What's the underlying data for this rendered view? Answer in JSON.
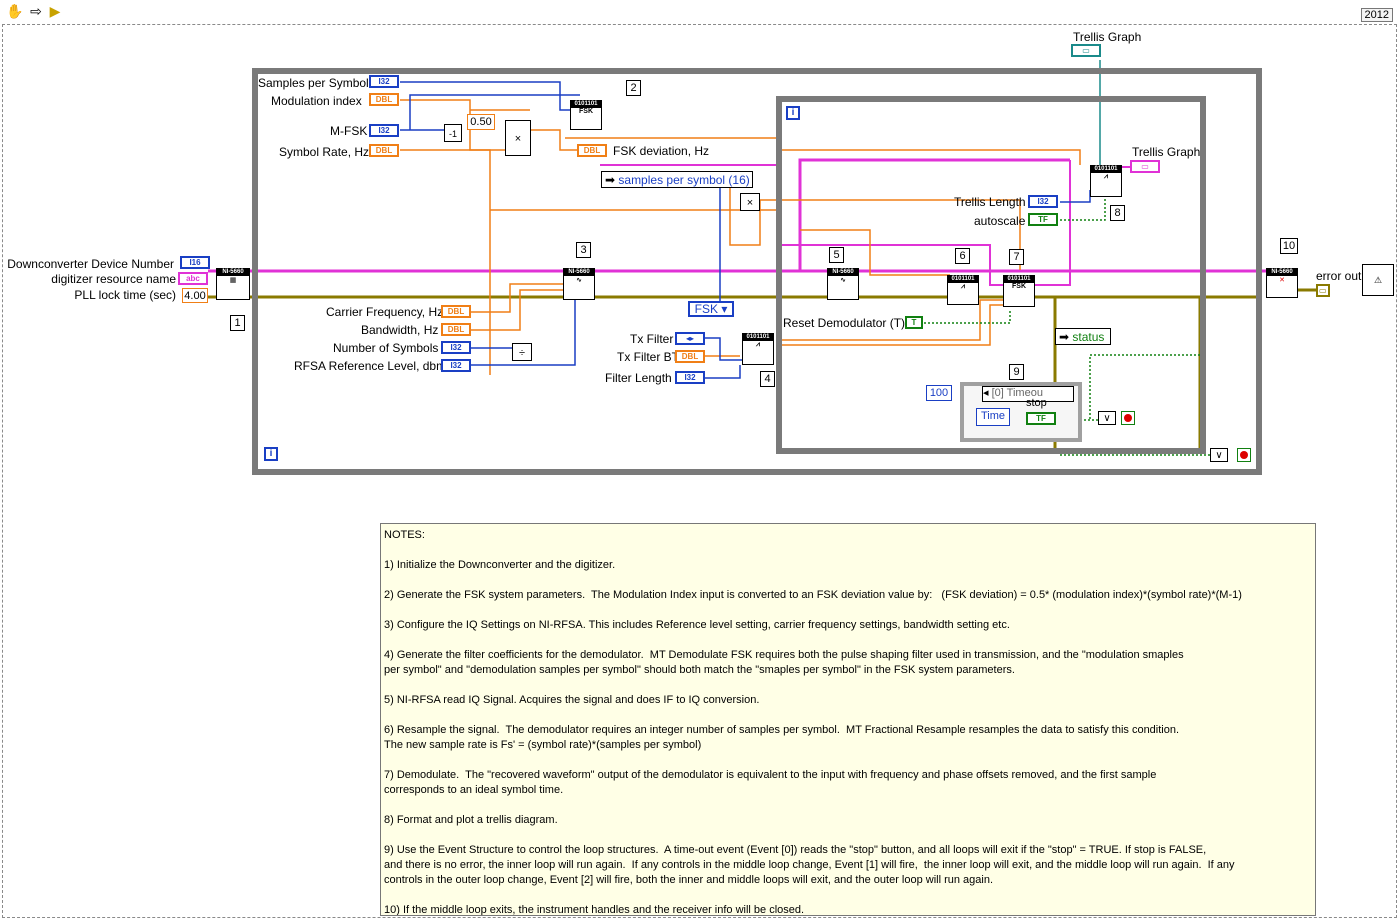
{
  "toolbar": {
    "version": "2012"
  },
  "inputs_left": {
    "downconverter_device_number": "Downconverter Device Number",
    "digitizer_resource_name": "digitizer resource name",
    "pll_lock_time": "PLL lock time (sec)",
    "pll_lock_time_value": "4.00"
  },
  "outer_loop": {
    "samples_per_symbol": "Samples per Symbol",
    "modulation_index": "Modulation index",
    "m_fsk": "M-FSK",
    "symbol_rate": "Symbol Rate, Hz",
    "const_050": "0.50",
    "fsk_deviation": "FSK deviation, Hz",
    "samples_per_symbol_16": "samples per symbol (16)",
    "carrier_frequency": "Carrier Frequency, Hz",
    "bandwidth": "Bandwidth, Hz",
    "number_of_symbols": "Number of Symbols",
    "rfsa_reference_level": "RFSA Reference Level, dbm",
    "tx_filter": "Tx Filter",
    "tx_filter_bt": "Tx Filter BT",
    "filter_length": "Filter Length",
    "fsk_enum": "FSK",
    "loop_i": "i"
  },
  "inner_loop": {
    "reset_demodulator": "Reset Demodulator (T)",
    "trellis_length": "Trellis Length",
    "autoscale": "autoscale",
    "trellis_graph": "Trellis Graph",
    "status": "status",
    "event_case": "[0] Timeou",
    "timeout_value": "100",
    "time": "Time",
    "stop": "stop",
    "loop_i": "i"
  },
  "top": {
    "trellis_graph": "Trellis Graph"
  },
  "right": {
    "error_out": "error out"
  },
  "term_labels": {
    "i32": "I32",
    "dbl": "DBL",
    "i16": "I16",
    "str": "abc",
    "tf": "TF",
    "ni5660": "NI-5660",
    "binary": "0101101",
    "fsk": "FSK"
  },
  "step_numbers": [
    "1",
    "2",
    "3",
    "4",
    "5",
    "6",
    "7",
    "8",
    "9",
    "10"
  ],
  "notes": {
    "title": "NOTES:",
    "items": [
      "1) Initialize the Downconverter and the digitizer.",
      "2) Generate the FSK system parameters.  The Modulation Index input is converted to an FSK deviation value by:   (FSK deviation) = 0.5* (modulation index)*(symbol rate)*(M-1)",
      "3) Configure the IQ Settings on NI-RFSA. This includes Reference level setting, carrier frequency settings, bandwidth setting etc.",
      "4) Generate the filter coefficients for the demodulator.  MT Demodulate FSK requires both the pulse shaping filter used in transmission, and the \"modulation smaples\nper symbol\" and \"demodulation samples per symbol\" should both match the \"smaples per symbol\" in the FSK system parameters.",
      "5) NI-RFSA read IQ Signal. Acquires the signal and does IF to IQ conversion.",
      "6) Resample the signal.  The demodulator requires an integer number of samples per symbol.  MT Fractional Resample resamples the data to satisfy this condition.\nThe new sample rate is Fs' = (symbol rate)*(samples per symbol)",
      "7) Demodulate.  The \"recovered waveform\" output of the demodulator is equivalent to the input with frequency and phase offsets removed, and the first sample\ncorresponds to an ideal symbol time.",
      "8) Format and plot a trellis diagram.",
      "9) Use the Event Structure to control the loop structures.  A time-out event (Event [0]) reads the \"stop\" button, and all loops will exit if the \"stop\" = TRUE. If stop is FALSE,\nand there is no error, the inner loop will run again.  If any controls in the middle loop change, Event [1] will fire,  the inner loop will exit, and the middle loop will run again.  If any\ncontrols in the outer loop change, Event [2] will fire, both the inner and middle loops will exit, and the outer loop will run again.",
      "10) If the middle loop exits, the instrument handles and the receiver info will be closed."
    ]
  }
}
